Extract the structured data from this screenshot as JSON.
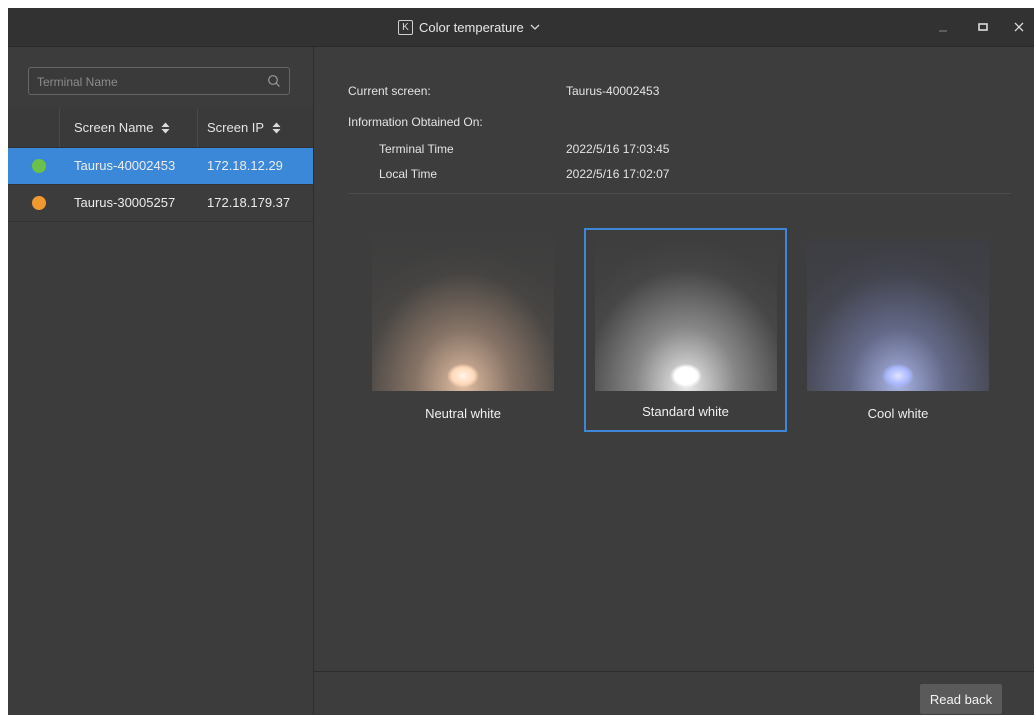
{
  "window": {
    "title": "Color temperature",
    "title_icon_letter": "K"
  },
  "sidebar": {
    "search_placeholder": "Terminal Name",
    "columns": {
      "name": "Screen Name",
      "ip": "Screen IP"
    },
    "rows": [
      {
        "name": "Taurus-40002453",
        "ip": "172.18.12.29",
        "status_color": "#6ac24a",
        "selected": true
      },
      {
        "name": "Taurus-30005257",
        "ip": "172.18.179.37",
        "status_color": "#ef9a2f",
        "selected": false
      }
    ]
  },
  "info": {
    "current_screen_label": "Current screen:",
    "current_screen_value": "Taurus-40002453",
    "obtained_label": "Information Obtained On:",
    "terminal_time_label": "Terminal Time",
    "terminal_time_value": "2022/5/16 17:03:45",
    "local_time_label": "Local Time",
    "local_time_value": "2022/5/16 17:02:07"
  },
  "presets": [
    {
      "label": "Neutral white",
      "glow_color": "#ffd9b8",
      "active": false
    },
    {
      "label": "Standard white",
      "glow_color": "#ffffff",
      "active": true
    },
    {
      "label": "Cool white",
      "glow_color": "#a9b7ff",
      "active": false
    }
  ],
  "footer": {
    "read_back_label": "Read back"
  },
  "colors": {
    "accent": "#3b87d8",
    "selected_border": "#3f86d6"
  }
}
